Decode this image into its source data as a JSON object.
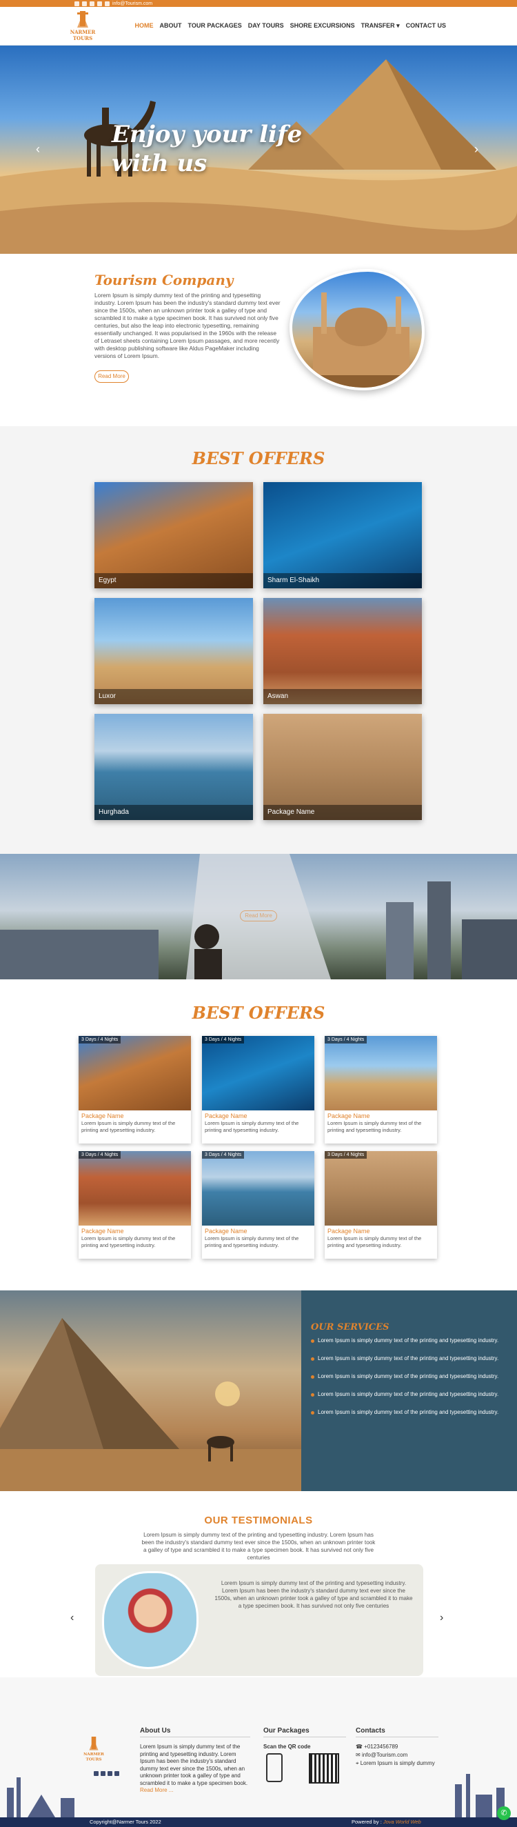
{
  "topbar": {
    "email": "info@Tourism.com"
  },
  "header": {
    "logo_text": [
      "NARMER",
      "TOURS"
    ],
    "nav": [
      "HOME",
      "ABOUT",
      "TOUR PACKAGES",
      "DAY TOURS",
      "SHORE EXCURSIONS",
      "TRANSFER",
      "CONTACT US"
    ],
    "active": "HOME"
  },
  "hero": {
    "title": "Enjoy your life\nwith us"
  },
  "about": {
    "title": "Tourism Company",
    "text": "Lorem Ipsum is simply dummy text of the printing and typesetting industry. Lorem Ipsum has been the industry's standard dummy text ever since the 1500s, when an unknown printer took a galley of type and scrambled it to make a type specimen book. It has survived not only five centuries, but also the leap into electronic typesetting, remaining essentially unchanged. It was popularised in the 1960s with the release of Letraset sheets containing Lorem Ipsum passages, and more recently with desktop publishing software like Aldus PageMaker including versions of Lorem Ipsum.",
    "button": "Read More"
  },
  "offers": {
    "title": "BEST OFFERS",
    "items": [
      "Egypt",
      "Sharm El-Shaikh",
      "Luxor",
      "Aswan",
      "Hurghada",
      "Package Name"
    ]
  },
  "video": {
    "button": "Read More"
  },
  "packages": {
    "title": "BEST OFFERS",
    "items": [
      {
        "badge": "3 Days / 4 Nights",
        "name": "Package Name",
        "desc": "Lorem Ipsum is simply dummy text of the printing and typesetting industry."
      },
      {
        "badge": "3 Days / 4 Nights",
        "name": "Package Name",
        "desc": "Lorem Ipsum is simply dummy text of the printing and typesetting industry."
      },
      {
        "badge": "3 Days / 4 Nights",
        "name": "Package Name",
        "desc": "Lorem Ipsum is simply dummy text of the printing and typesetting industry."
      },
      {
        "badge": "3 Days / 4 Nights",
        "name": "Package Name",
        "desc": "Lorem Ipsum is simply dummy text of the printing and typesetting industry."
      },
      {
        "badge": "3 Days / 4 Nights",
        "name": "Package Name",
        "desc": "Lorem Ipsum is simply dummy text of the printing and typesetting industry."
      },
      {
        "badge": "3 Days / 4 Nights",
        "name": "Package Name",
        "desc": "Lorem Ipsum is simply dummy text of the printing and typesetting industry."
      }
    ]
  },
  "services": {
    "title": "OUR SERVICES",
    "items": [
      "Lorem Ipsum is simply dummy text of the printing and typesetting industry.",
      "Lorem Ipsum is simply dummy text of the printing and typesetting industry.",
      "Lorem Ipsum is simply dummy text of the printing and typesetting industry.",
      "Lorem Ipsum is simply dummy text of the printing and typesetting industry.",
      "Lorem Ipsum is simply dummy text of the printing and typesetting industry."
    ]
  },
  "testimonials": {
    "title": "OUR TESTIMONIALS",
    "intro": "Lorem Ipsum is simply dummy text of the printing and typesetting industry. Lorem Ipsum has been the industry's standard dummy text ever since the 1500s, when an unknown printer took a galley of type and scrambled it to make a type specimen book. It has survived not only five centuries",
    "quote": "Lorem Ipsum is simply dummy text of the printing and typesetting industry. Lorem Ipsum has been the industry's standard dummy text ever since the 1500s, when an unknown printer took a galley of type and scrambled it to make a type specimen book. It has survived not only five centuries"
  },
  "footer": {
    "about_title": "About Us",
    "about_text": "Lorem Ipsum is simply dummy text of the printing and typesetting industry. Lorem Ipsum has been the industry's standard dummy text ever since the 1500s, when an unknown printer took a galley of type and scrambled it to make a type specimen book.",
    "about_more": "Read More ...",
    "packages_title": "Our Packages",
    "qr_label": "Scan the QR code",
    "contacts_title": "Contacts",
    "phone": "+0123456789",
    "email": "info@Tourism.com",
    "address": "Lorem Ipsum is simply dummy",
    "copyright": "Copyright@Narmer Tours 2022",
    "powered_label": "Powered by :",
    "powered_by": "Jova World Web"
  },
  "colors": {
    "accent": "#e0832d",
    "services_bg": "#33586c",
    "footer_bar": "#1c2d57"
  }
}
